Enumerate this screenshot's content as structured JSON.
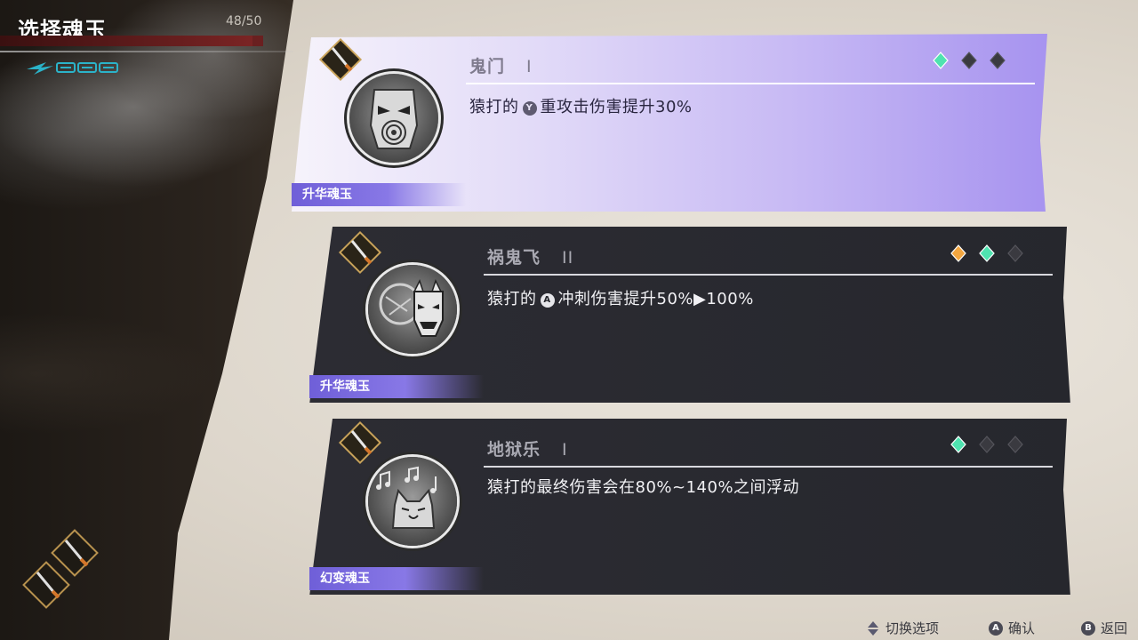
{
  "hud": {
    "title": "选择魂玉",
    "hp_text": "48/50",
    "hp_fraction": 0.96
  },
  "cards": [
    {
      "name": "鬼门",
      "level": "I",
      "desc_prefix": "猿打的",
      "button": "Y",
      "desc_suffix": "重攻击伤害提升30%",
      "tag": "升华魂玉",
      "emblem_icon": "oni-mask-spiral-icon",
      "gems": [
        "green",
        "dark",
        "dark"
      ],
      "selected": true
    },
    {
      "name": "祸鬼飞",
      "level": "II",
      "desc_prefix": "猿打的",
      "button": "A",
      "desc_suffix": "冲刺伤害提升50%▶100%",
      "tag": "升华魂玉",
      "emblem_icon": "hannya-mask-icon",
      "gems": [
        "orange",
        "green",
        "dark"
      ],
      "selected": false
    },
    {
      "name": "地狱乐",
      "level": "I",
      "desc_prefix": "猿打的最终伤害会在80%~140%之间浮动",
      "button": "",
      "desc_suffix": "",
      "tag": "幻变魂玉",
      "emblem_icon": "music-cat-icon",
      "gems": [
        "green",
        "dark",
        "dark"
      ],
      "selected": false
    }
  ],
  "footer": {
    "switch_label": "切换选项",
    "confirm_button": "A",
    "confirm_label": "确认",
    "back_button": "B",
    "back_label": "返回"
  },
  "colors": {
    "accent_purple": "#8878e6",
    "gem_green": "#4fe3b0",
    "gem_orange": "#f2a640",
    "gem_dark": "#3a3a40"
  }
}
